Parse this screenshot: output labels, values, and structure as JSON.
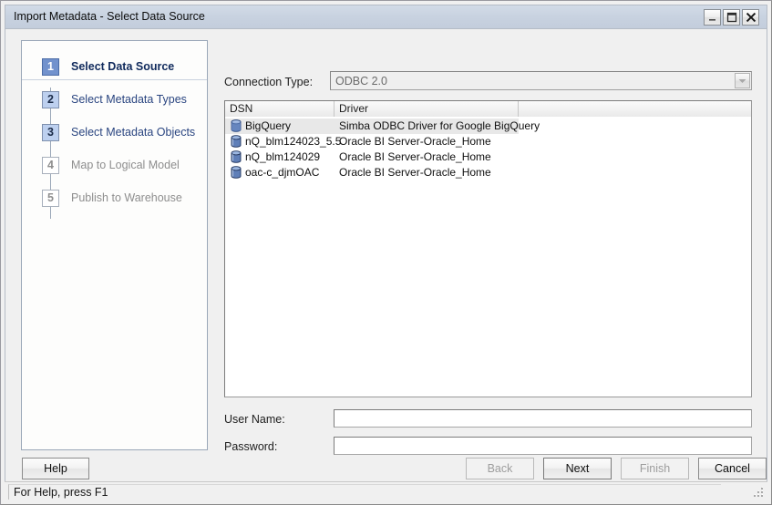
{
  "window": {
    "title": "Import Metadata - Select Data Source",
    "caption_buttons": [
      {
        "name": "minimize",
        "label": "–"
      },
      {
        "name": "maximize",
        "label": "☐"
      },
      {
        "name": "close",
        "label": "✕"
      }
    ]
  },
  "wizard": {
    "steps": [
      {
        "number": "1",
        "label": "Select Data Source",
        "state": "current"
      },
      {
        "number": "2",
        "label": "Select Metadata Types",
        "state": "enabled"
      },
      {
        "number": "3",
        "label": "Select Metadata Objects",
        "state": "enabled"
      },
      {
        "number": "4",
        "label": "Map to Logical Model",
        "state": "disabled"
      },
      {
        "number": "5",
        "label": "Publish to Warehouse",
        "state": "disabled"
      }
    ]
  },
  "form": {
    "connection_type_label": "Connection Type:",
    "connection_type_value": "ODBC 2.0",
    "user_name_label": "User Name:",
    "user_name_value": "",
    "user_name_placeholder": "",
    "password_label": "Password:",
    "password_value": "",
    "password_placeholder": ""
  },
  "dsn_list": {
    "columns": [
      "DSN",
      "Driver",
      ""
    ],
    "rows": [
      {
        "dsn": "BigQuery",
        "driver": "Simba ODBC Driver for Google BigQuery",
        "selected": true
      },
      {
        "dsn": "nQ_blm124023_5.5",
        "driver": "Oracle BI Server-Oracle_Home",
        "selected": false
      },
      {
        "dsn": "nQ_blm124029",
        "driver": "Oracle BI Server-Oracle_Home",
        "selected": false
      },
      {
        "dsn": "oac-c_djmOAC",
        "driver": "Oracle BI Server-Oracle_Home",
        "selected": false
      }
    ]
  },
  "buttons": {
    "help": {
      "label": "Help",
      "enabled": true
    },
    "back": {
      "label": "Back",
      "enabled": false
    },
    "next": {
      "label": "Next",
      "enabled": true
    },
    "finish": {
      "label": "Finish",
      "enabled": false
    },
    "cancel": {
      "label": "Cancel",
      "enabled": true
    }
  },
  "statusbar": {
    "text": "For Help, press F1"
  },
  "colors": {
    "titlebar": "#c8d2e0",
    "current_step_badge": "#7292cd",
    "enabled_step_badge": "#bdd0ef",
    "step_label": "#2a4580",
    "disabled_text": "#8e8e8e",
    "selection": "#e8e8e8",
    "window_bg": "#f0f0f0"
  }
}
